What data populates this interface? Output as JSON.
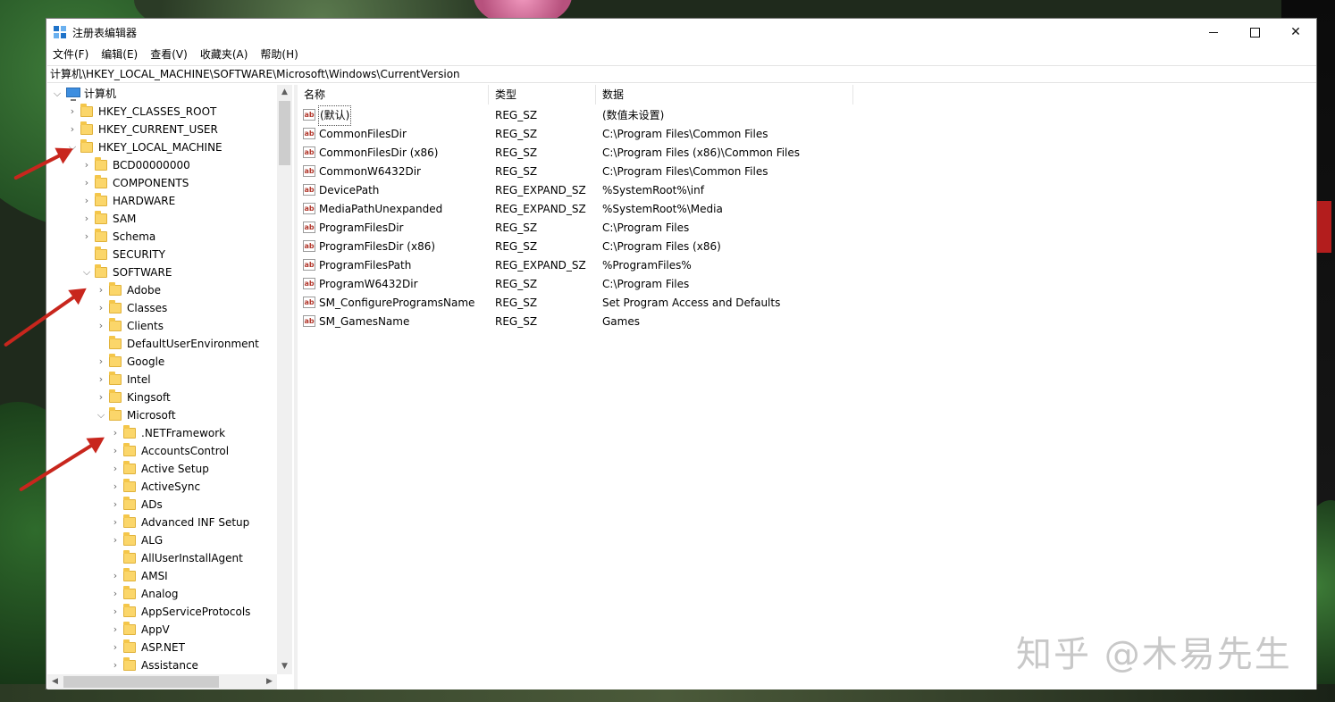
{
  "window": {
    "title": "注册表编辑器",
    "controls": {
      "minimize": "—",
      "maximize": "☐",
      "close": "✕"
    }
  },
  "menu": [
    "文件(F)",
    "编辑(E)",
    "查看(V)",
    "收藏夹(A)",
    "帮助(H)"
  ],
  "address": "计算机\\HKEY_LOCAL_MACHINE\\SOFTWARE\\Microsoft\\Windows\\CurrentVersion",
  "tree": {
    "root": "计算机",
    "items": [
      {
        "label": "HKEY_CLASSES_ROOT",
        "level": 1,
        "expander": "collapsed"
      },
      {
        "label": "HKEY_CURRENT_USER",
        "level": 1,
        "expander": "collapsed"
      },
      {
        "label": "HKEY_LOCAL_MACHINE",
        "level": 1,
        "expander": "expanded"
      },
      {
        "label": "BCD00000000",
        "level": 2,
        "expander": "collapsed"
      },
      {
        "label": "COMPONENTS",
        "level": 2,
        "expander": "collapsed"
      },
      {
        "label": "HARDWARE",
        "level": 2,
        "expander": "collapsed"
      },
      {
        "label": "SAM",
        "level": 2,
        "expander": "collapsed"
      },
      {
        "label": "Schema",
        "level": 2,
        "expander": "collapsed"
      },
      {
        "label": "SECURITY",
        "level": 2,
        "expander": "none"
      },
      {
        "label": "SOFTWARE",
        "level": 2,
        "expander": "expanded"
      },
      {
        "label": "Adobe",
        "level": 3,
        "expander": "collapsed"
      },
      {
        "label": "Classes",
        "level": 3,
        "expander": "collapsed"
      },
      {
        "label": "Clients",
        "level": 3,
        "expander": "collapsed"
      },
      {
        "label": "DefaultUserEnvironment",
        "level": 3,
        "expander": "none"
      },
      {
        "label": "Google",
        "level": 3,
        "expander": "collapsed"
      },
      {
        "label": "Intel",
        "level": 3,
        "expander": "collapsed"
      },
      {
        "label": "Kingsoft",
        "level": 3,
        "expander": "collapsed"
      },
      {
        "label": "Microsoft",
        "level": 3,
        "expander": "expanded"
      },
      {
        "label": ".NETFramework",
        "level": 4,
        "expander": "collapsed"
      },
      {
        "label": "AccountsControl",
        "level": 4,
        "expander": "collapsed"
      },
      {
        "label": "Active Setup",
        "level": 4,
        "expander": "collapsed"
      },
      {
        "label": "ActiveSync",
        "level": 4,
        "expander": "collapsed"
      },
      {
        "label": "ADs",
        "level": 4,
        "expander": "collapsed"
      },
      {
        "label": "Advanced INF Setup",
        "level": 4,
        "expander": "collapsed"
      },
      {
        "label": "ALG",
        "level": 4,
        "expander": "collapsed"
      },
      {
        "label": "AllUserInstallAgent",
        "level": 4,
        "expander": "none"
      },
      {
        "label": "AMSI",
        "level": 4,
        "expander": "collapsed"
      },
      {
        "label": "Analog",
        "level": 4,
        "expander": "collapsed"
      },
      {
        "label": "AppServiceProtocols",
        "level": 4,
        "expander": "collapsed"
      },
      {
        "label": "AppV",
        "level": 4,
        "expander": "collapsed"
      },
      {
        "label": "ASP.NET",
        "level": 4,
        "expander": "collapsed"
      },
      {
        "label": "Assistance",
        "level": 4,
        "expander": "collapsed"
      }
    ]
  },
  "columns": {
    "name": "名称",
    "type": "类型",
    "data": "数据"
  },
  "values": [
    {
      "name": "(默认)",
      "type": "REG_SZ",
      "data": "(数值未设置)"
    },
    {
      "name": "CommonFilesDir",
      "type": "REG_SZ",
      "data": "C:\\Program Files\\Common Files"
    },
    {
      "name": "CommonFilesDir (x86)",
      "type": "REG_SZ",
      "data": "C:\\Program Files (x86)\\Common Files"
    },
    {
      "name": "CommonW6432Dir",
      "type": "REG_SZ",
      "data": "C:\\Program Files\\Common Files"
    },
    {
      "name": "DevicePath",
      "type": "REG_EXPAND_SZ",
      "data": "%SystemRoot%\\inf"
    },
    {
      "name": "MediaPathUnexpanded",
      "type": "REG_EXPAND_SZ",
      "data": "%SystemRoot%\\Media"
    },
    {
      "name": "ProgramFilesDir",
      "type": "REG_SZ",
      "data": "C:\\Program Files"
    },
    {
      "name": "ProgramFilesDir (x86)",
      "type": "REG_SZ",
      "data": "C:\\Program Files (x86)"
    },
    {
      "name": "ProgramFilesPath",
      "type": "REG_EXPAND_SZ",
      "data": "%ProgramFiles%"
    },
    {
      "name": "ProgramW6432Dir",
      "type": "REG_SZ",
      "data": "C:\\Program Files"
    },
    {
      "name": "SM_ConfigureProgramsName",
      "type": "REG_SZ",
      "data": "Set Program Access and Defaults"
    },
    {
      "name": "SM_GamesName",
      "type": "REG_SZ",
      "data": "Games"
    }
  ],
  "value_icon": "ab",
  "watermark": "知乎 @木易先生",
  "colors": {
    "arrow": "#c8261d",
    "folder": "#fbd66a"
  }
}
